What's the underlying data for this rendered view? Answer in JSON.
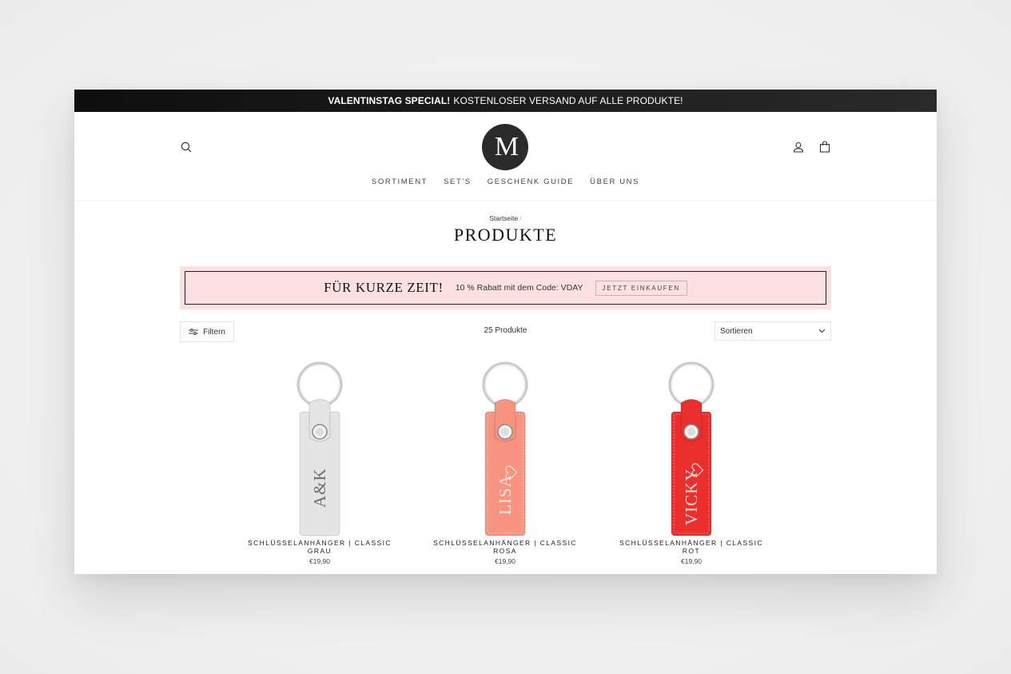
{
  "announcement": {
    "bold": "VALENTINSTAG SPECIAL!",
    "text": "KOSTENLOSER VERSAND AUF ALLE PRODUKTE!"
  },
  "logo": {
    "text": "M"
  },
  "nav": [
    "SORTIMENT",
    "SET'S",
    "GESCHENK GUIDE",
    "ÜBER UNS"
  ],
  "breadcrumb": {
    "home": "Startseite",
    "separator": "/"
  },
  "page_title": "PRODUKTE",
  "promo": {
    "heading": "FÜR KURZE ZEIT!",
    "text": "10 % Rabatt mit dem Code: VDAY",
    "button": "JETZT EINKAUFEN",
    "background": "#fde0e2"
  },
  "toolbar": {
    "filter_label": "Filtern",
    "count": "25 Produkte",
    "sort_label": "Sortieren"
  },
  "products": [
    {
      "title": "SCHLÜSSELANHÄNGER | CLASSIC GRAU",
      "price": "€19,90",
      "engraving": "A&K",
      "color": "#e4e4e4",
      "heart": false
    },
    {
      "title": "SCHLÜSSELANHÄNGER | CLASSIC ROSA",
      "price": "€19,90",
      "engraving": "LISA",
      "color": "#f7937f",
      "heart": true
    },
    {
      "title": "SCHLÜSSELANHÄNGER | CLASSIC ROT",
      "price": "€19,90",
      "engraving": "VICKY",
      "color": "#ea2f2d",
      "heart": true
    }
  ],
  "icons": {
    "search": "search-icon",
    "account": "user-icon",
    "cart": "shopping-bag-icon",
    "filter": "sliders-icon",
    "sort": "chevron-down-icon"
  }
}
